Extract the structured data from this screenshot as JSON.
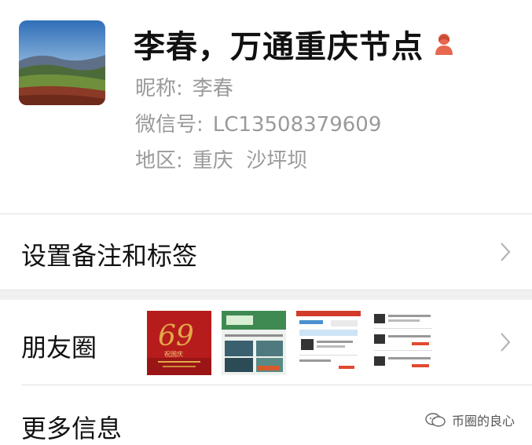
{
  "profile": {
    "name": "李春，万通重庆节点",
    "nickname_label": "昵称:",
    "nickname": "李春",
    "wechat_id_label": "微信号:",
    "wechat_id": "LC13508379609",
    "region_label": "地区:",
    "region": "重庆  沙坪坝",
    "gender_icon": "female-person-icon",
    "accent_color": "#e8684f"
  },
  "rows": {
    "remark_tags": "设置备注和标签",
    "moments": "朋友圈",
    "more_info": "更多信息"
  },
  "moments_thumbnails": [
    {
      "name": "moment-thumb-national-day",
      "caption": "祝国庆"
    },
    {
      "name": "moment-thumb-mining-farm",
      "caption": ""
    },
    {
      "name": "moment-thumb-mining-rig-1",
      "caption": ""
    },
    {
      "name": "moment-thumb-mining-rig-2",
      "caption": ""
    }
  ],
  "watermark": {
    "icon": "wechat-account-icon",
    "text": "币圈的良心"
  }
}
